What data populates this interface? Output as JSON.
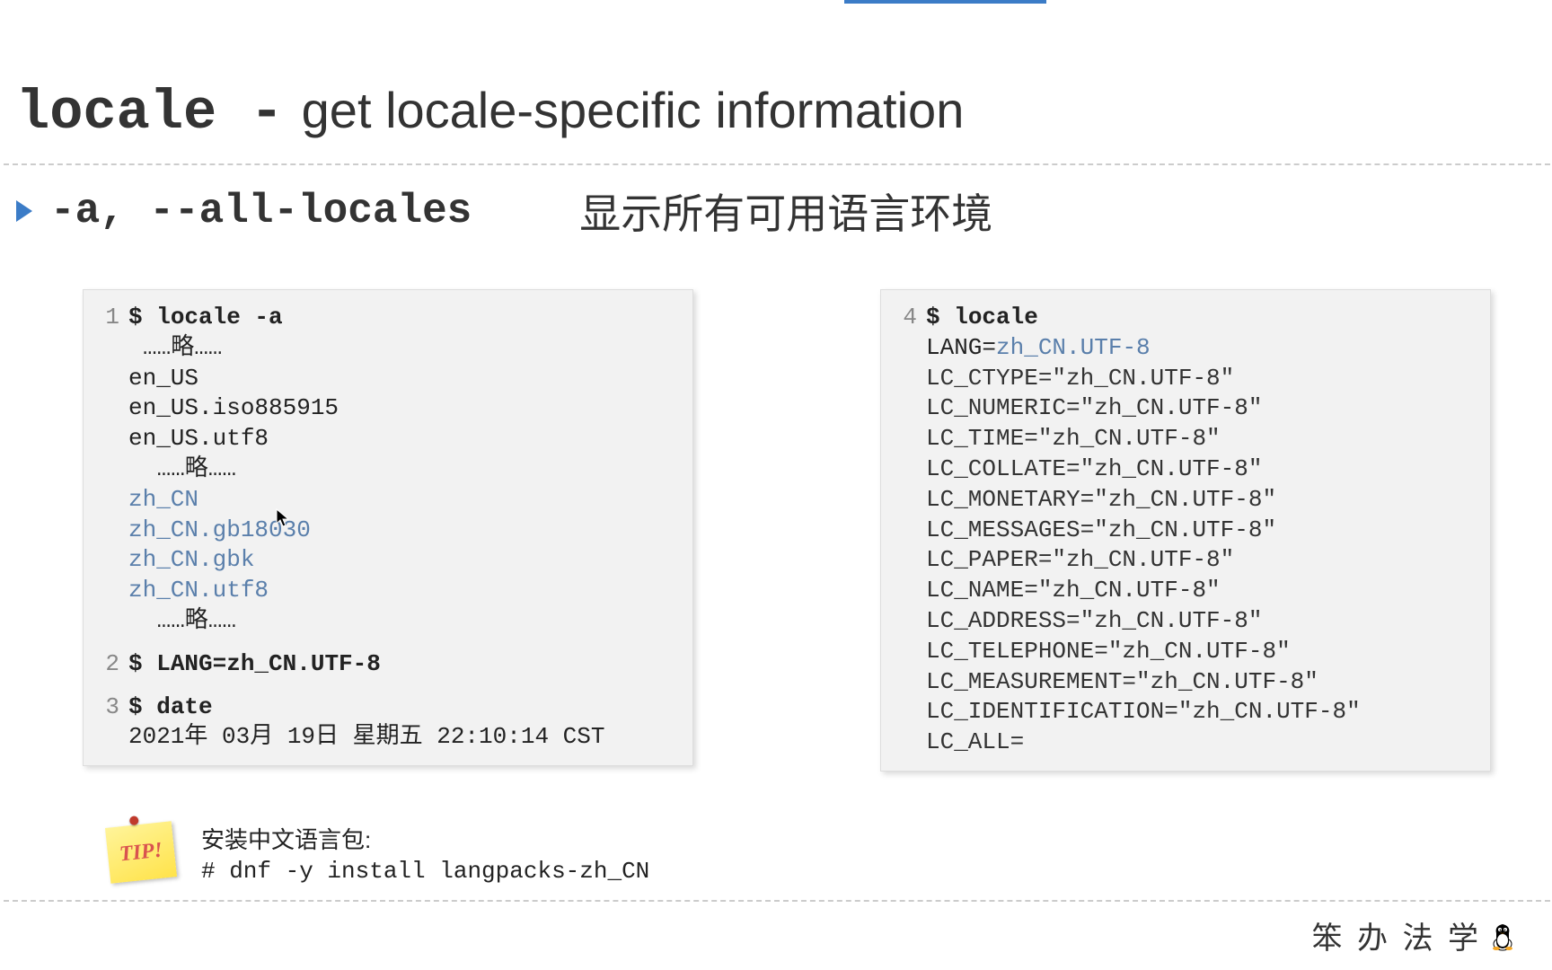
{
  "title": {
    "cmd": "locale -",
    "desc": "get locale-specific information"
  },
  "option": {
    "flag": "-a, --all-locales",
    "desc": "显示所有可用语言环境"
  },
  "left": {
    "n1": "1",
    "p1": "$ ",
    "c1": "locale -a",
    "e1": "……略……",
    "o1": "en_US",
    "o2": "en_US.iso885915",
    "o3": "en_US.utf8",
    "e2": " ……略……",
    "z1": "zh_CN",
    "z2": "zh_CN.gb18030",
    "z3": "zh_CN.gbk",
    "z4": "zh_CN.utf8",
    "e3": " ……略……",
    "n2": "2",
    "p2": "$ ",
    "c2": "LANG=zh_CN.UTF-8",
    "n3": "3",
    "p3": "$ ",
    "c3": "date",
    "o4": "2021年 03月 19日 星期五 22:10:14 CST"
  },
  "right": {
    "n4": "4",
    "p4": "$ ",
    "c4": "locale",
    "lang_k": "LANG=",
    "lang_v": "zh_CN.UTF-8",
    "l1": "LC_CTYPE=\"zh_CN.UTF-8\"",
    "l2": "LC_NUMERIC=\"zh_CN.UTF-8\"",
    "l3": "LC_TIME=\"zh_CN.UTF-8\"",
    "l4": "LC_COLLATE=\"zh_CN.UTF-8\"",
    "l5": "LC_MONETARY=\"zh_CN.UTF-8\"",
    "l6": "LC_MESSAGES=\"zh_CN.UTF-8\"",
    "l7": "LC_PAPER=\"zh_CN.UTF-8\"",
    "l8": "LC_NAME=\"zh_CN.UTF-8\"",
    "l9": "LC_ADDRESS=\"zh_CN.UTF-8\"",
    "l10": "LC_TELEPHONE=\"zh_CN.UTF-8\"",
    "l11": "LC_MEASUREMENT=\"zh_CN.UTF-8\"",
    "l12": "LC_IDENTIFICATION=\"zh_CN.UTF-8\"",
    "l13": "LC_ALL="
  },
  "tip": {
    "label": "TIP!",
    "line1": "安装中文语言包:",
    "line2": "# dnf -y install langpacks-zh_CN"
  },
  "brand": "笨 办 法 学"
}
